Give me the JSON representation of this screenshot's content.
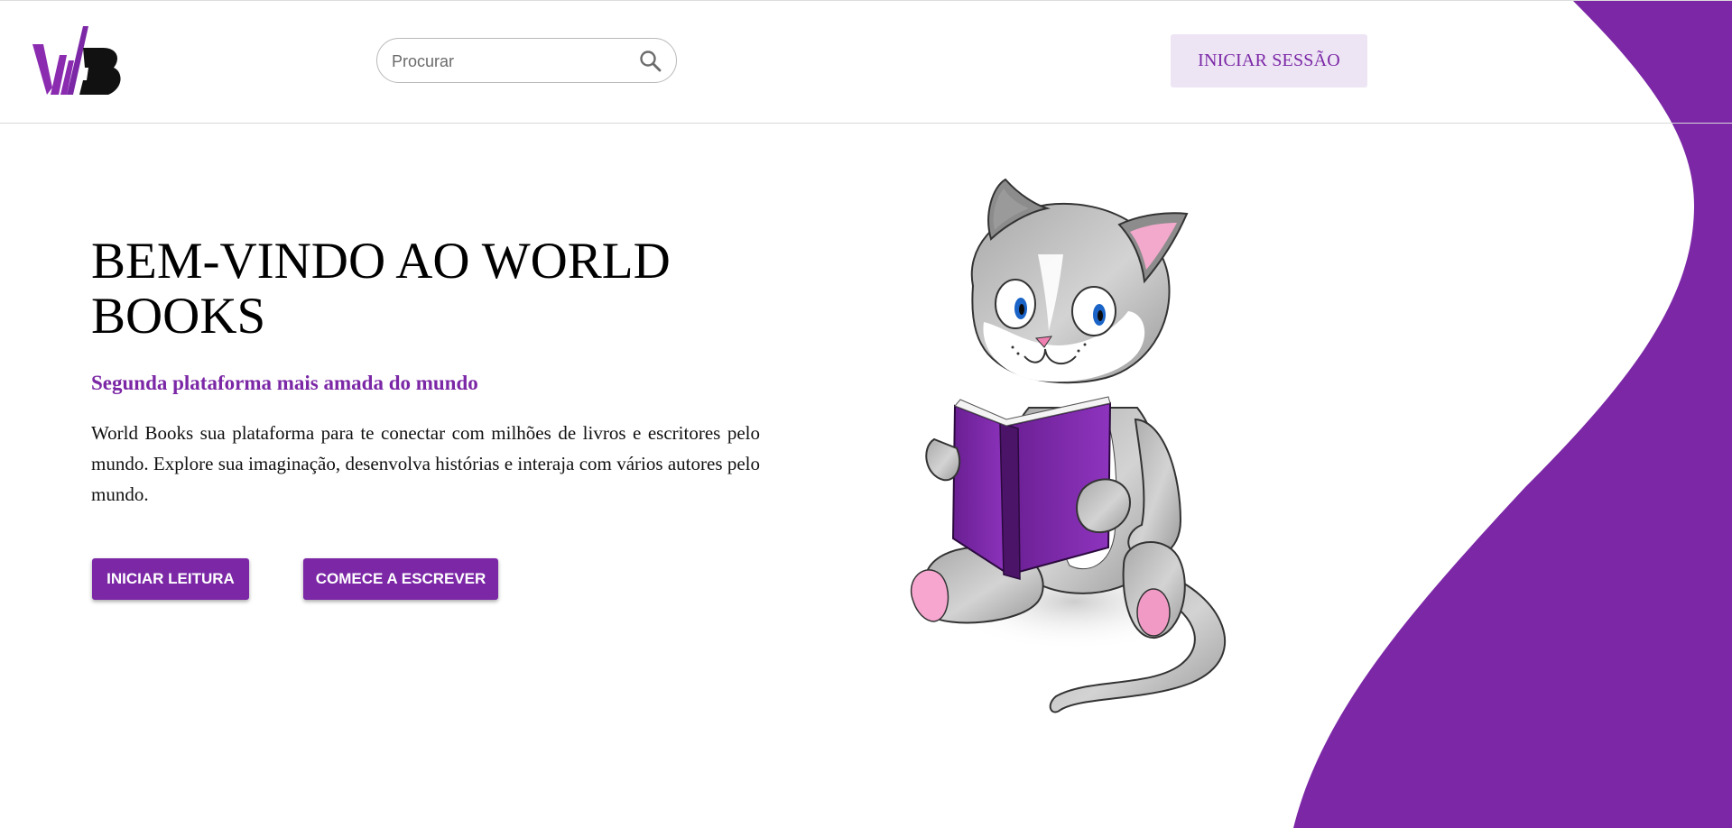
{
  "brand": {
    "logo_text": "WB",
    "accent_color": "#7b27a6"
  },
  "header": {
    "search": {
      "placeholder": "Procurar",
      "icon": "search-icon"
    },
    "login_label": "INICIAR SESSÃO"
  },
  "hero": {
    "title": "BEM-VINDO AO WORLD BOOKS",
    "subtitle": "Segunda plataforma mais amada do mundo",
    "description": "World Books sua plataforma para te conectar com milhões de livros e escritores pelo mundo. Explore sua imaginação, desenvolva histórias e interaja com vários autores pelo mundo.",
    "buttons": {
      "read_label": "INICIAR LEITURA",
      "write_label": "COMECE A ESCREVER"
    },
    "illustration": "cat-reading-book-illustration"
  }
}
